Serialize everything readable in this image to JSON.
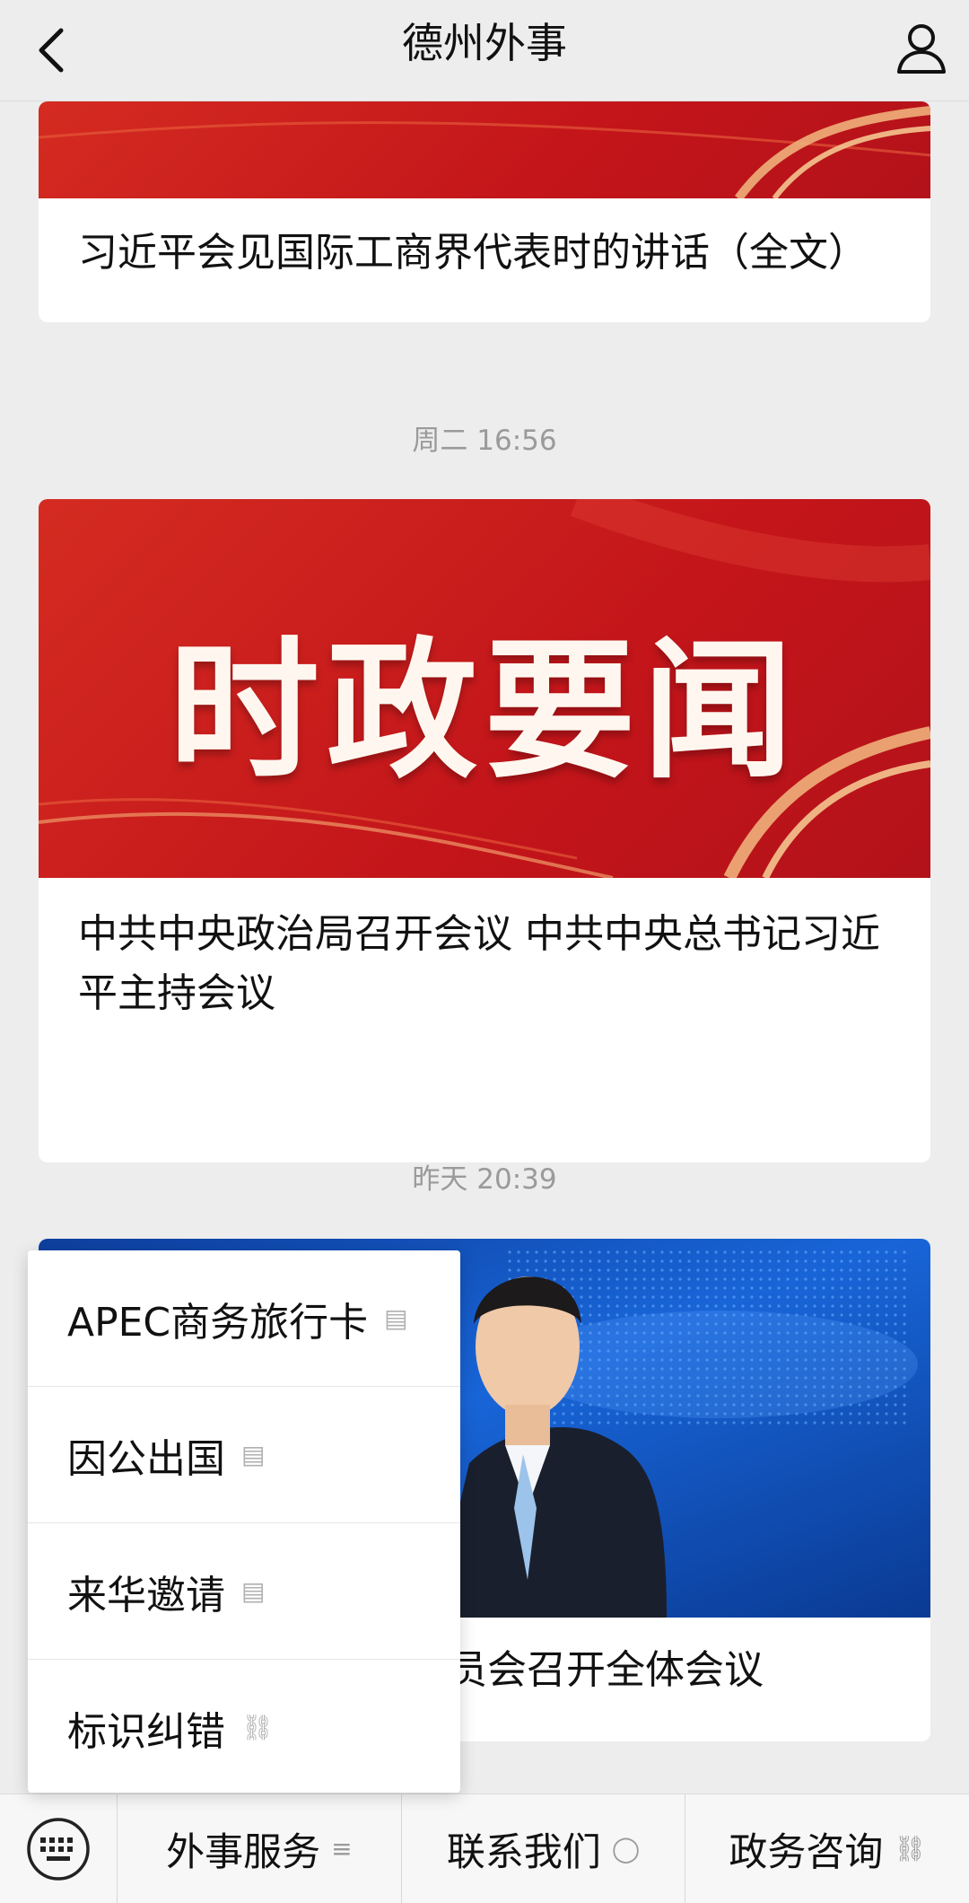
{
  "nav": {
    "title": "德州外事"
  },
  "feed": [
    {
      "headline": "习近平会见国际工商界代表时的讲话（全文）"
    },
    {
      "timestamp": "周二 16:56",
      "banner_text": "时政要闻",
      "headline": "中共中央政治局召开会议 中共中央总书记习近平主持会议"
    },
    {
      "timestamp": "昨天 20:39",
      "headline": "员会召开全体会议"
    }
  ],
  "popup_menu": {
    "items": [
      {
        "label": "APEC商务旅行卡",
        "icon": "doc-icon"
      },
      {
        "label": "因公出国",
        "icon": "doc-icon"
      },
      {
        "label": "来华邀请",
        "icon": "doc-icon"
      },
      {
        "label": "标识纠错",
        "icon": "link-icon"
      }
    ]
  },
  "tabbar": {
    "tabs": [
      {
        "label": "外事服务",
        "icon": "menu-icon"
      },
      {
        "label": "联系我们",
        "icon": "chat-icon"
      },
      {
        "label": "政务咨询",
        "icon": "link-icon"
      }
    ]
  }
}
